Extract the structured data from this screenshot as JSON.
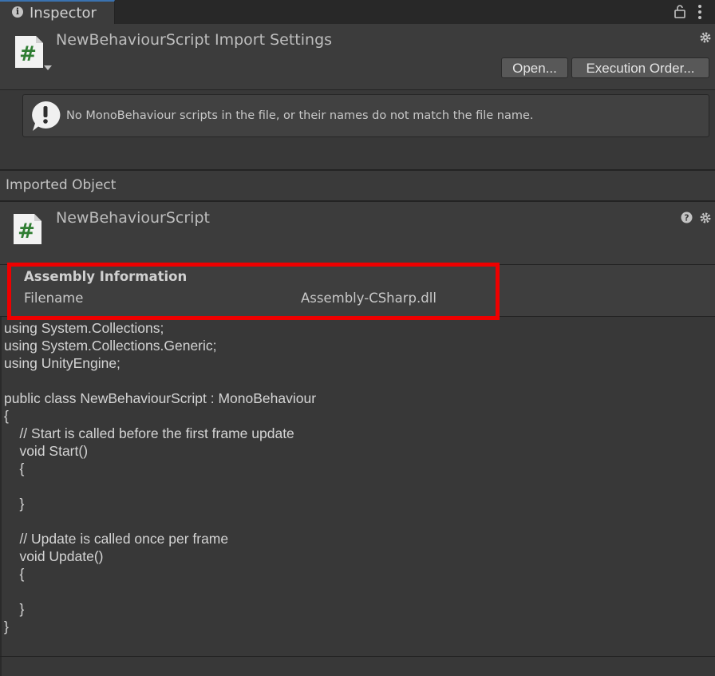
{
  "tab": {
    "label": "Inspector",
    "icon": "info-icon"
  },
  "header": {
    "title": "NewBehaviourScript Import Settings",
    "icon": "csharp-script-icon",
    "buttons": {
      "open": "Open...",
      "execution_order": "Execution Order..."
    }
  },
  "warning": {
    "text": "No MonoBehaviour scripts in the file, or their names do not match the file name."
  },
  "imported_object": {
    "label": "Imported Object",
    "title": "NewBehaviourScript"
  },
  "assembly": {
    "title": "Assembly Information",
    "filename_label": "Filename",
    "filename_value": "Assembly-CSharp.dll"
  },
  "code_lines": [
    "using System.Collections;",
    "using System.Collections.Generic;",
    "using UnityEngine;",
    "",
    "public class NewBehaviourScript : MonoBehaviour",
    "{",
    "    // Start is called before the first frame update",
    "    void Start()",
    "    {",
    "",
    "    }",
    "",
    "    // Update is called once per frame",
    "    void Update()",
    "    {",
    "",
    "    }",
    "}"
  ],
  "colors": {
    "highlight": "#ee0000",
    "script_hash": "#2f7d32",
    "tab_accent": "#3a72b0"
  }
}
